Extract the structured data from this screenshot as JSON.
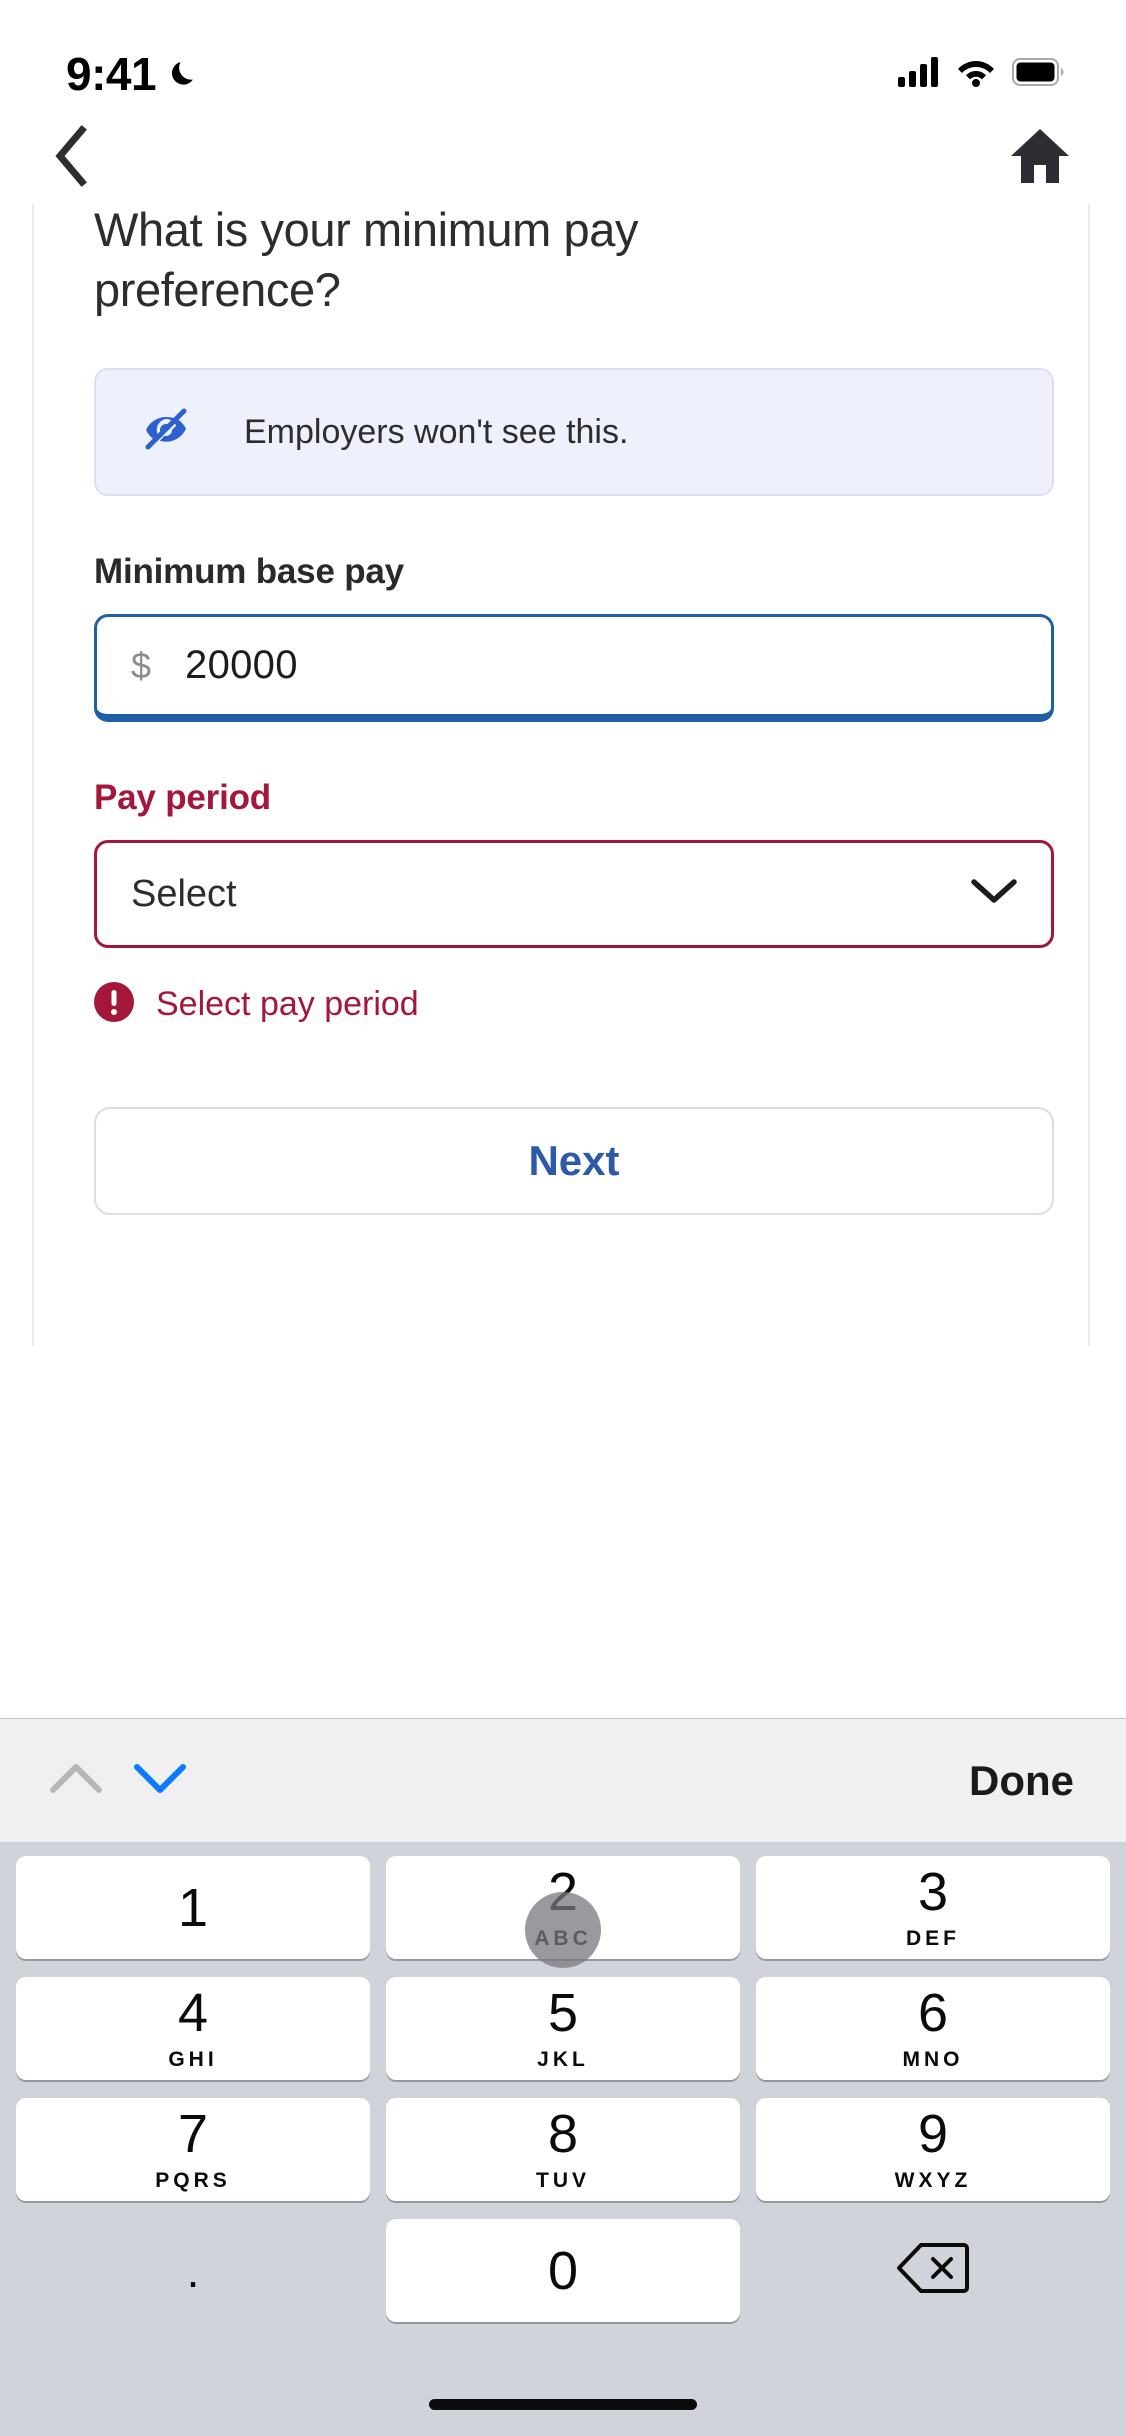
{
  "status_bar": {
    "time": "9:41",
    "dnd_icon": "crescent-moon-icon",
    "signal_icon": "cellular-signal-icon",
    "wifi_icon": "wifi-icon",
    "battery_icon": "battery-full-icon"
  },
  "nav_bar": {
    "back_icon": "chevron-left-icon",
    "home_icon": "home-icon"
  },
  "main": {
    "heading": "What is your minimum pay preference?",
    "banner": {
      "icon": "eye-slash-icon",
      "text": "Employers won't see this.",
      "background_color": "#eef0fb",
      "icon_color": "#2e61cf"
    },
    "base_pay": {
      "label": "Minimum base pay",
      "prefix": "$",
      "value": "20000",
      "placeholder": "",
      "focus_color": "#1f5fa8"
    },
    "pay_period": {
      "label": "Pay period",
      "value": "Select",
      "chevron_icon": "chevron-down-icon",
      "error_icon": "error-circle-icon",
      "error_text": "Select pay period",
      "error_color": "#a5173a"
    },
    "next_button": {
      "label": "Next",
      "text_color": "#2b5aa8"
    }
  },
  "keyboard": {
    "toolbar": {
      "prev_icon": "chevron-up-icon",
      "next_icon": "chevron-down-icon",
      "prev_enabled": "false",
      "next_enabled": "true",
      "done_label": "Done"
    },
    "rows": [
      [
        {
          "digit": "1",
          "letters": ""
        },
        {
          "digit": "2",
          "letters": "ABC",
          "pressed": "true"
        },
        {
          "digit": "3",
          "letters": "DEF"
        }
      ],
      [
        {
          "digit": "4",
          "letters": "GHI"
        },
        {
          "digit": "5",
          "letters": "JKL"
        },
        {
          "digit": "6",
          "letters": "MNO"
        }
      ],
      [
        {
          "digit": "7",
          "letters": "PQRS"
        },
        {
          "digit": "8",
          "letters": "TUV"
        },
        {
          "digit": "9",
          "letters": "WXYZ"
        }
      ],
      [
        {
          "digit": ".",
          "letters": "",
          "style": "blank"
        },
        {
          "digit": "0",
          "letters": ""
        },
        {
          "digit": "",
          "letters": "",
          "style": "blank",
          "icon": "backspace-icon"
        }
      ]
    ]
  }
}
